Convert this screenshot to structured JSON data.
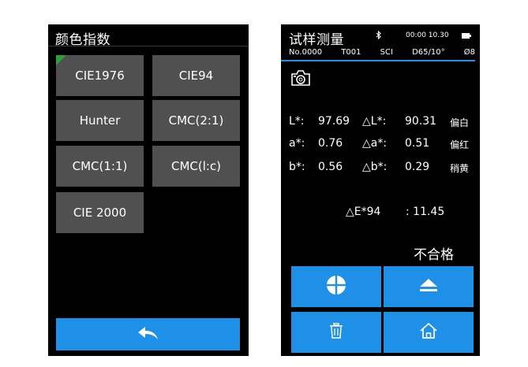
{
  "left_screen": {
    "title": "颜色指数",
    "tiles": [
      {
        "label": "CIE1976",
        "selected": true
      },
      {
        "label": "CIE94",
        "selected": false
      },
      {
        "label": "Hunter",
        "selected": false
      },
      {
        "label": "CMC(2:1)",
        "selected": false
      },
      {
        "label": "CMC(1:1)",
        "selected": false
      },
      {
        "label": "CMC(l:c)",
        "selected": false
      },
      {
        "label": "CIE 2000",
        "selected": false
      }
    ],
    "back_icon": "back-arrow-icon"
  },
  "right_screen": {
    "title": "试样测量",
    "bluetooth_icon": "bluetooth-icon",
    "time": "00:00 10.30",
    "battery_icon": "battery-icon",
    "info": {
      "sample_no": "No.0000",
      "target": "T001",
      "mode": "SCI",
      "illuminant": "D65/10°",
      "aperture": "Ø8"
    },
    "camera_icon": "camera-icon",
    "measurements": [
      {
        "label": "L*:",
        "value": "97.69",
        "delta_label": "△L*:",
        "delta_value": "90.31",
        "note": "偏白"
      },
      {
        "label": "a*:",
        "value": "0.76",
        "delta_label": "△a*:",
        "delta_value": "0.51",
        "note": "偏红"
      },
      {
        "label": "b*:",
        "value": "0.56",
        "delta_label": "△b*:",
        "delta_value": "0.29",
        "note": "稍黄"
      }
    ],
    "delta_e_label": "△E*94",
    "delta_e_value": ":  11.45",
    "verdict": "不合格",
    "buttons": [
      "crosshair-icon",
      "eject-icon",
      "trash-icon",
      "home-icon"
    ],
    "colors": {
      "accent": "#1e90e8",
      "tile": "#505050",
      "selected_marker": "#2e9e3e"
    }
  }
}
